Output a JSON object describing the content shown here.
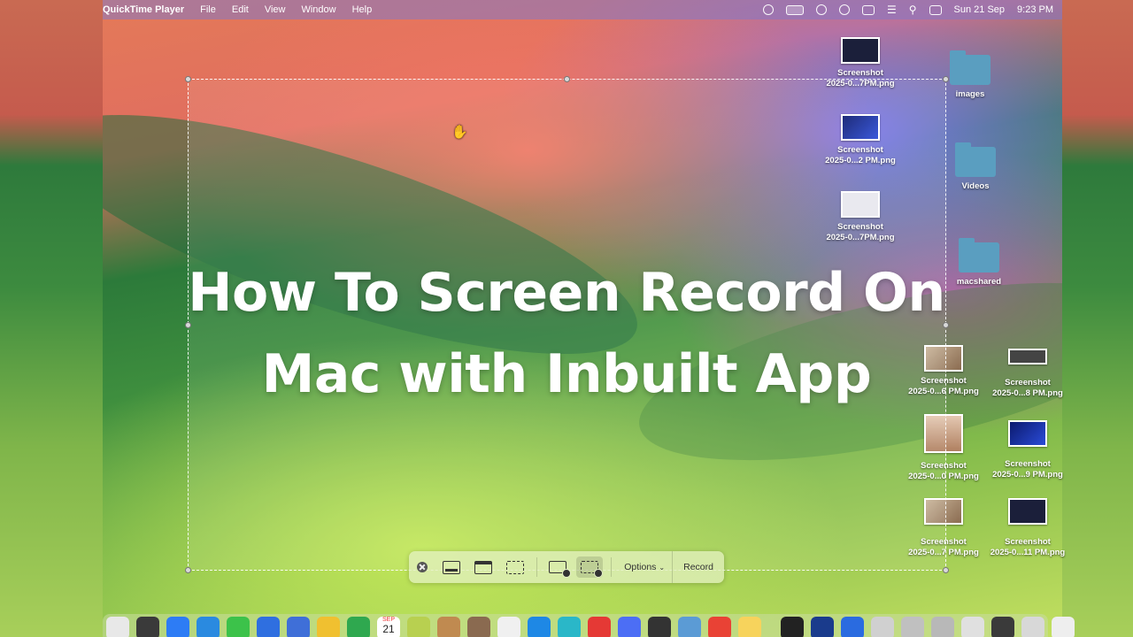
{
  "menubar": {
    "app_name": "QuickTime Player",
    "menus": [
      "File",
      "Edit",
      "View",
      "Window",
      "Help"
    ],
    "date": "Sun 21 Sep",
    "time": "9:23 PM"
  },
  "overlay_title": {
    "line1": "How To Screen Record On",
    "line2": "Mac with Inbuilt App"
  },
  "desktop": {
    "screenshots_col1": [
      {
        "name1": "Screenshot",
        "name2": "2025-0...7PM.png",
        "style": "dark"
      },
      {
        "name1": "Screenshot",
        "name2": "2025-0...2 PM.png",
        "style": "blue"
      },
      {
        "name1": "Screenshot",
        "name2": "2025-0...7PM.png",
        "style": "light"
      }
    ],
    "folders": [
      {
        "name": "images"
      },
      {
        "name": "Videos"
      },
      {
        "name": "macshared"
      }
    ],
    "screenshots_grid": [
      {
        "name1": "Screenshot",
        "name2": "2025-0...6 PM.png",
        "style": "photo"
      },
      {
        "name1": "Screenshot",
        "name2": "2025-0...8 PM.png",
        "style": "gray"
      },
      {
        "name1": "Screenshot",
        "name2": "2025-0...0 PM.png",
        "style": "tall"
      },
      {
        "name1": "Screenshot",
        "name2": "2025-0...9 PM.png",
        "style": "blue"
      },
      {
        "name1": "Screenshot",
        "name2": "2025-0...7 PM.png",
        "style": "photo"
      },
      {
        "name1": "Screenshot",
        "name2": "2025-0...11 PM.png",
        "style": "dark"
      }
    ]
  },
  "toolbar": {
    "options_label": "Options",
    "record_label": "Record"
  },
  "dock": {
    "calendar_month": "SEP",
    "calendar_day": "21",
    "colors": [
      "#e8e8e8",
      "#3a3a3a",
      "#2d7cf5",
      "#2a8ae0",
      "#3cc24a",
      "#2f6fe0",
      "#3f6fd8",
      "#f0c030",
      "#2fa84f",
      "#e94040",
      "#b8d050",
      "#c08a50",
      "#8a6a50",
      "#f0f0f0",
      "#1e88e5",
      "#2ab7c8",
      "#e53935",
      "#4c6ef5",
      "#333333",
      "#5b9bd5",
      "#e94235",
      "#f7d35c",
      "#222222",
      "#1a3b8c",
      "#2a6be0",
      "#d0d0d0",
      "#c0c0c0",
      "#b8b8b8",
      "#e0e0e0",
      "#3a3a3a",
      "#d8d8d8",
      "#eeeeee"
    ]
  }
}
